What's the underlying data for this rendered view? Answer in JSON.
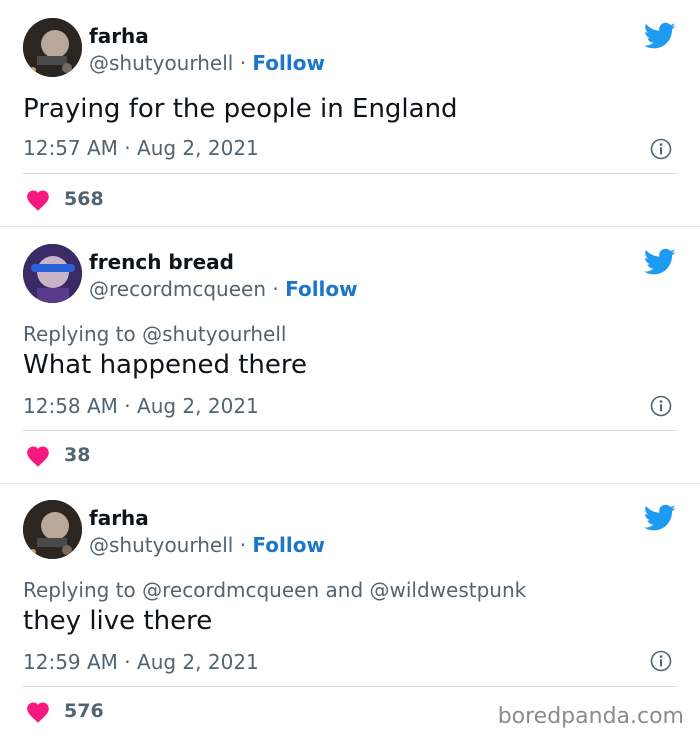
{
  "colors": {
    "follow": "#1d76c9",
    "heart": "#f91880",
    "twitter_blue": "#1d9bf0",
    "muted": "#536471"
  },
  "tweets": [
    {
      "name": "farha",
      "handle": "@shutyourhell",
      "separator": "·",
      "follow": "Follow",
      "reply_prefix": "",
      "reply_mention_1": "",
      "reply_joiner": "",
      "reply_mention_2": "",
      "text": "Praying for the people in England",
      "time": "12:57 AM",
      "date": "Aug 2, 2021",
      "likes": "568",
      "icons": {
        "platform": "twitter-bird-icon",
        "info": "info-icon",
        "like": "heart-icon"
      }
    },
    {
      "name": "french bread",
      "handle": "@recordmcqueen",
      "separator": "·",
      "follow": "Follow",
      "reply_prefix": "Replying to",
      "reply_mention_1": "@shutyourhell",
      "reply_joiner": "",
      "reply_mention_2": "",
      "text": "What happened there",
      "time": "12:58 AM",
      "date": "Aug 2, 2021",
      "likes": "38",
      "icons": {
        "platform": "twitter-bird-icon",
        "info": "info-icon",
        "like": "heart-icon"
      }
    },
    {
      "name": "farha",
      "handle": "@shutyourhell",
      "separator": "·",
      "follow": "Follow",
      "reply_prefix": "Replying to",
      "reply_mention_1": "@recordmcqueen",
      "reply_joiner": "and",
      "reply_mention_2": "@wildwestpunk",
      "text": "they live there",
      "time": "12:59 AM",
      "date": "Aug 2, 2021",
      "likes": "576",
      "icons": {
        "platform": "twitter-bird-icon",
        "info": "info-icon",
        "like": "heart-icon"
      }
    }
  ],
  "watermark": "boredpanda.com"
}
